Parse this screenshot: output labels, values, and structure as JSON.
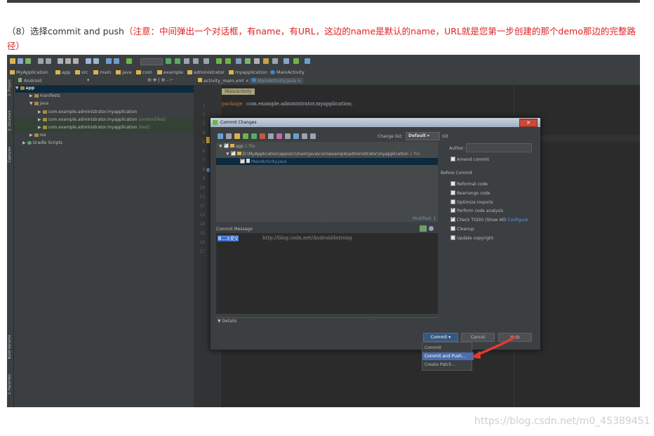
{
  "caption": {
    "prefix": "（8）选择commit and push",
    "note": "（注意：中间弹出一个对话框，有name，有URL，这边的name是默认的name，URL就是您第一步创建的那个demo那边的完整路径）"
  },
  "ide": {
    "breadcrumbs": [
      "MyApplication",
      "app",
      "src",
      "main",
      "java",
      "com",
      "example",
      "administrator",
      "myapplication",
      "MainActivity"
    ],
    "sidebar_labels": [
      "1: Project",
      "2: Structure",
      "Captures",
      "Build Variants",
      "2: Favorites"
    ],
    "project_view": "Android",
    "tree": [
      {
        "label": "app",
        "level": 0
      },
      {
        "label": "manifests",
        "level": 1
      },
      {
        "label": "java",
        "level": 1
      },
      {
        "label": "com.example.administrator.myapplication",
        "level": 2,
        "suffix": ""
      },
      {
        "label": "com.example.administrator.myapplication",
        "level": 2,
        "suffix": "(androidTest)"
      },
      {
        "label": "com.example.administrator.myapplication",
        "level": 2,
        "suffix": "(test)"
      },
      {
        "label": "res",
        "level": 1
      },
      {
        "label": "Gradle Scripts",
        "level": 0
      }
    ],
    "tabs": [
      {
        "label": "activity_main.xml",
        "active": false
      },
      {
        "label": "MainActivity.java",
        "active": true
      }
    ],
    "editor": {
      "crumb": "MainActivity",
      "line_numbers": [
        "1",
        "2",
        "3",
        "4",
        "5",
        "6",
        "7",
        "8",
        "9",
        "10",
        "11",
        "12",
        "13",
        "14",
        "15",
        "16",
        "17"
      ],
      "code_line1_keyword": "package",
      "code_line1_text": "com.example.administrator.myapplication;"
    }
  },
  "dialog": {
    "title": "Commit Changes",
    "changelist_label": "Change list:",
    "changelist_value": "Default",
    "git_label": "Git",
    "tree": {
      "root": "app",
      "root_count": "1 file",
      "path": "D:\\MyApplication\\app\\src\\main\\java\\com\\example\\administrator\\myapplication",
      "path_count": "1 file",
      "file": "MainActivity.java"
    },
    "modified": "Modified: 1",
    "commit_message_label": "Commit Message",
    "commit_message": "第二次提交",
    "watermark_in_box": "http://blog.csdn.net/Android4strong",
    "author_label": "Author:",
    "amend": "Amend commit",
    "before_commit_label": "Before Commit",
    "options": [
      {
        "label": "Reformat code",
        "checked": false
      },
      {
        "label": "Rearrange code",
        "checked": false
      },
      {
        "label": "Optimize imports",
        "checked": false
      },
      {
        "label": "Perform code analysis",
        "checked": true
      },
      {
        "label": "Check TODO (Show All)",
        "checked": true,
        "link": "Configure"
      },
      {
        "label": "Cleanup",
        "checked": false
      },
      {
        "label": "Update copyright",
        "checked": false
      }
    ],
    "details": "Details",
    "buttons": {
      "commit": "Commit ▾",
      "cancel": "Cancel",
      "help": "Help"
    },
    "menu": [
      "Commit",
      "Commit and Push...",
      "Create Patch..."
    ]
  },
  "colors": {
    "caption_note": "#e02020",
    "ide_bg": "#2b2b2b",
    "panel": "#3c3f41",
    "selection": "#4b6eaf",
    "arrow": "#e53a30"
  },
  "watermark": "https://blog.csdn.net/m0_45389451"
}
